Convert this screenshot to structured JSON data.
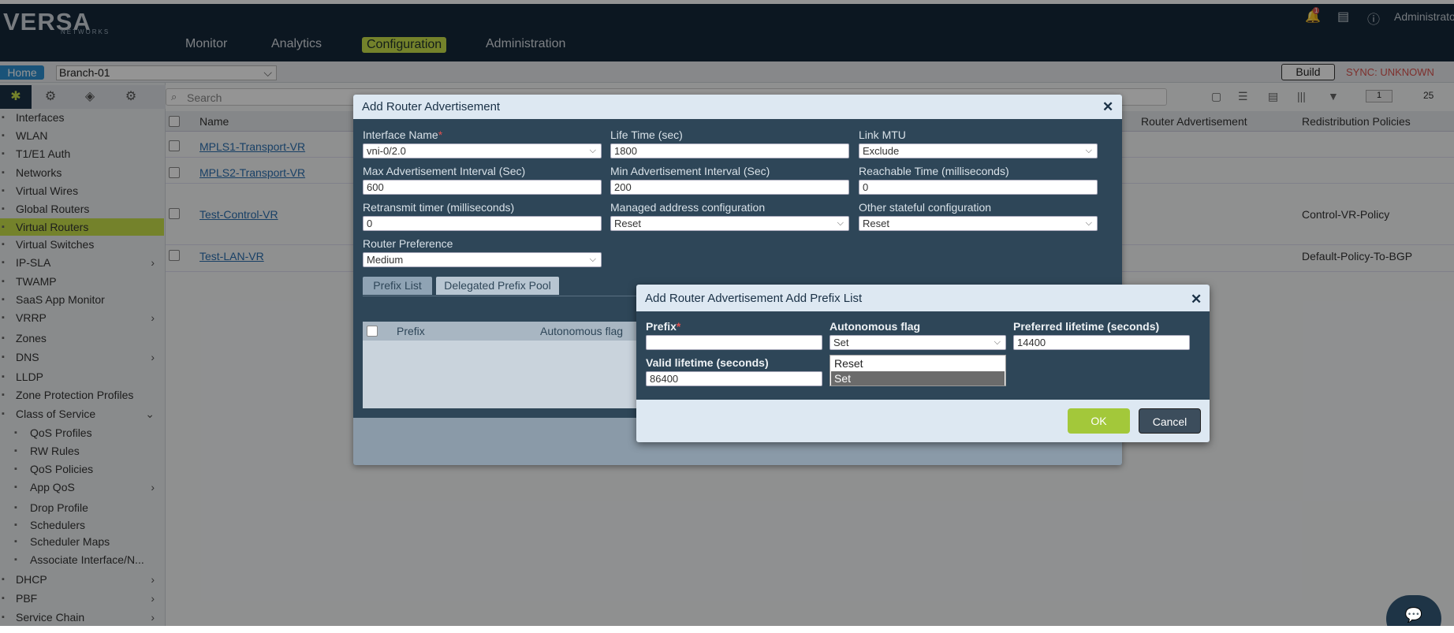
{
  "header": {
    "logo_text": "VERSA",
    "logo_sub": "NETWORKS",
    "nav": [
      "Monitor",
      "Analytics",
      "Configuration",
      "Administration"
    ],
    "active_nav": "Configuration",
    "admin_label": "Administrator",
    "notification_count": "1"
  },
  "subbar": {
    "home_label": "Home",
    "branch_value": "Branch-01",
    "build_label": "Build",
    "sync_status": "SYNC: UNKNOWN"
  },
  "sidebar": {
    "items": [
      {
        "label": "Interfaces",
        "icon": "interfaces-icon"
      },
      {
        "label": "WLAN",
        "icon": "wlan-icon"
      },
      {
        "label": "T1/E1 Auth",
        "icon": "t1e1-icon"
      },
      {
        "label": "Networks",
        "icon": "networks-icon"
      },
      {
        "label": "Virtual Wires",
        "icon": "virtual-wires-icon"
      },
      {
        "label": "Global Routers",
        "icon": "global-routers-icon"
      },
      {
        "label": "Virtual Routers",
        "icon": "virtual-routers-icon"
      },
      {
        "label": "Virtual Switches",
        "icon": "virtual-switches-icon"
      },
      {
        "label": "IP-SLA",
        "icon": "ipsla-icon"
      },
      {
        "label": "TWAMP",
        "icon": "twamp-icon"
      },
      {
        "label": "SaaS App Monitor",
        "icon": "saas-icon"
      },
      {
        "label": "VRRP",
        "icon": "vrrp-icon"
      },
      {
        "label": "Zones",
        "icon": "zones-icon"
      },
      {
        "label": "DNS",
        "icon": "dns-icon"
      },
      {
        "label": "LLDP",
        "icon": "lldp-icon"
      },
      {
        "label": "Zone Protection Profiles",
        "icon": "zone-protection-icon"
      },
      {
        "label": "Class of Service",
        "icon": "cos-icon"
      },
      {
        "label": "QoS Profiles",
        "icon": "qos-profiles-icon"
      },
      {
        "label": "RW Rules",
        "icon": "rw-rules-icon"
      },
      {
        "label": "QoS Policies",
        "icon": "qos-policies-icon"
      },
      {
        "label": "App QoS",
        "icon": "app-qos-icon"
      },
      {
        "label": "Drop Profile",
        "icon": "drop-profile-icon"
      },
      {
        "label": "Schedulers",
        "icon": "schedulers-icon"
      },
      {
        "label": "Scheduler Maps",
        "icon": "scheduler-maps-icon"
      },
      {
        "label": "Associate Interface/N...",
        "icon": "associate-icon"
      },
      {
        "label": "DHCP",
        "icon": "dhcp-icon"
      },
      {
        "label": "PBF",
        "icon": "pbf-icon"
      },
      {
        "label": "Service Chain",
        "icon": "service-chain-icon"
      }
    ],
    "active_item": "Virtual Routers"
  },
  "toolbar": {
    "search_placeholder": "Search",
    "page_value": "1",
    "per_page": "25"
  },
  "table": {
    "columns": [
      "Name",
      "Router Advertisement",
      "Redistribution Policies"
    ],
    "rows": [
      {
        "name": "MPLS1-Transport-VR",
        "policy": ""
      },
      {
        "name": "MPLS2-Transport-VR",
        "policy": ""
      },
      {
        "name": "Test-Control-VR",
        "policy": "Control-VR-Policy"
      },
      {
        "name": "Test-LAN-VR",
        "policy": "Default-Policy-To-BGP"
      }
    ]
  },
  "modal_ra": {
    "title": "Add Router Advertisement",
    "fields": {
      "interface_name_label": "Interface Name",
      "interface_name_value": "vni-0/2.0",
      "life_time_label": "Life Time (sec)",
      "life_time_value": "1800",
      "link_mtu_label": "Link MTU",
      "link_mtu_value": "Exclude",
      "max_adv_label": "Max Advertisement Interval (Sec)",
      "max_adv_value": "600",
      "min_adv_label": "Min Advertisement Interval (Sec)",
      "min_adv_value": "200",
      "reachable_label": "Reachable Time (milliseconds)",
      "reachable_value": "0",
      "retransmit_label": "Retransmit timer (milliseconds)",
      "retransmit_value": "0",
      "managed_label": "Managed address configuration",
      "managed_value": "Reset",
      "other_label": "Other stateful configuration",
      "other_value": "Reset",
      "router_pref_label": "Router Preference",
      "router_pref_value": "Medium"
    },
    "tabs": [
      "Prefix List",
      "Delegated Prefix Pool"
    ],
    "grid_columns": [
      "Prefix",
      "Autonomous flag"
    ]
  },
  "modal_prefix": {
    "title": "Add Router Advertisement Add Prefix List",
    "prefix_label": "Prefix",
    "prefix_value": "",
    "autonomous_label": "Autonomous flag",
    "autonomous_value": "Set",
    "autonomous_options": [
      "Reset",
      "Set"
    ],
    "preferred_label": "Preferred lifetime (seconds)",
    "preferred_value": "14400",
    "valid_label": "Valid lifetime (seconds)",
    "valid_value": "86400",
    "ok_label": "OK",
    "cancel_label": "Cancel"
  },
  "colors": {
    "accent": "#c8e04a",
    "header_bg": "#16283a",
    "modal_bg": "#2e4658",
    "ok_button": "#a3c83a",
    "cancel_button": "#3c4d5c"
  }
}
